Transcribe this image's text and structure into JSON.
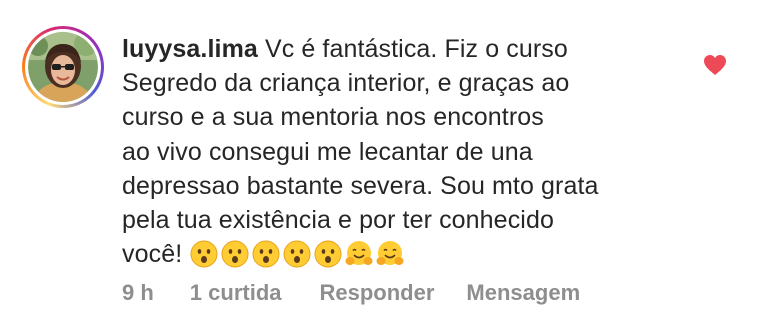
{
  "comment": {
    "username": "luyysa.lima",
    "lines": [
      "Vc é fantástica.  Fiz o curso",
      "Segredo da criança interior, e graças ao",
      "curso e a sua mentoria nos encontros",
      "ao vivo consegui me lecantar de una",
      "depressao bastante severa. Sou mto grata",
      "pela tua existência e por ter conhecido",
      "você!"
    ],
    "emojis": [
      "hushed-face",
      "hushed-face",
      "hushed-face",
      "hushed-face",
      "hushed-face",
      "hugging-face",
      "hugging-face"
    ],
    "liked": true,
    "heart_color": "#ed4956"
  },
  "meta": {
    "time": "9 h",
    "likes": "1 curtida",
    "reply_label": "Responder",
    "message_label": "Mensagem"
  },
  "colors": {
    "text": "#262626",
    "secondary": "#8e8e8e"
  }
}
